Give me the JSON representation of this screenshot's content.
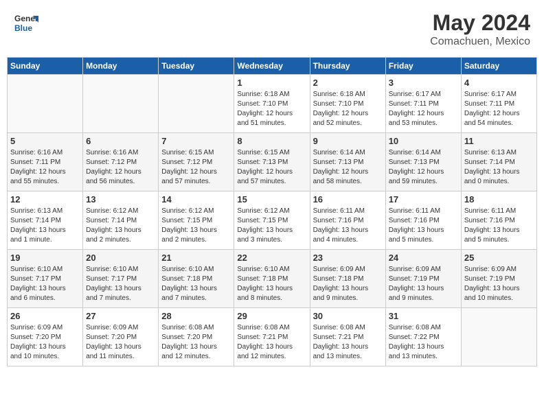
{
  "header": {
    "logo_general": "General",
    "logo_blue": "Blue",
    "month_year": "May 2024",
    "location": "Comachuen, Mexico"
  },
  "weekdays": [
    "Sunday",
    "Monday",
    "Tuesday",
    "Wednesday",
    "Thursday",
    "Friday",
    "Saturday"
  ],
  "weeks": [
    [
      {
        "day": "",
        "info": ""
      },
      {
        "day": "",
        "info": ""
      },
      {
        "day": "",
        "info": ""
      },
      {
        "day": "1",
        "info": "Sunrise: 6:18 AM\nSunset: 7:10 PM\nDaylight: 12 hours\nand 51 minutes."
      },
      {
        "day": "2",
        "info": "Sunrise: 6:18 AM\nSunset: 7:10 PM\nDaylight: 12 hours\nand 52 minutes."
      },
      {
        "day": "3",
        "info": "Sunrise: 6:17 AM\nSunset: 7:11 PM\nDaylight: 12 hours\nand 53 minutes."
      },
      {
        "day": "4",
        "info": "Sunrise: 6:17 AM\nSunset: 7:11 PM\nDaylight: 12 hours\nand 54 minutes."
      }
    ],
    [
      {
        "day": "5",
        "info": "Sunrise: 6:16 AM\nSunset: 7:11 PM\nDaylight: 12 hours\nand 55 minutes."
      },
      {
        "day": "6",
        "info": "Sunrise: 6:16 AM\nSunset: 7:12 PM\nDaylight: 12 hours\nand 56 minutes."
      },
      {
        "day": "7",
        "info": "Sunrise: 6:15 AM\nSunset: 7:12 PM\nDaylight: 12 hours\nand 57 minutes."
      },
      {
        "day": "8",
        "info": "Sunrise: 6:15 AM\nSunset: 7:13 PM\nDaylight: 12 hours\nand 57 minutes."
      },
      {
        "day": "9",
        "info": "Sunrise: 6:14 AM\nSunset: 7:13 PM\nDaylight: 12 hours\nand 58 minutes."
      },
      {
        "day": "10",
        "info": "Sunrise: 6:14 AM\nSunset: 7:13 PM\nDaylight: 12 hours\nand 59 minutes."
      },
      {
        "day": "11",
        "info": "Sunrise: 6:13 AM\nSunset: 7:14 PM\nDaylight: 13 hours\nand 0 minutes."
      }
    ],
    [
      {
        "day": "12",
        "info": "Sunrise: 6:13 AM\nSunset: 7:14 PM\nDaylight: 13 hours\nand 1 minute."
      },
      {
        "day": "13",
        "info": "Sunrise: 6:12 AM\nSunset: 7:14 PM\nDaylight: 13 hours\nand 2 minutes."
      },
      {
        "day": "14",
        "info": "Sunrise: 6:12 AM\nSunset: 7:15 PM\nDaylight: 13 hours\nand 2 minutes."
      },
      {
        "day": "15",
        "info": "Sunrise: 6:12 AM\nSunset: 7:15 PM\nDaylight: 13 hours\nand 3 minutes."
      },
      {
        "day": "16",
        "info": "Sunrise: 6:11 AM\nSunset: 7:16 PM\nDaylight: 13 hours\nand 4 minutes."
      },
      {
        "day": "17",
        "info": "Sunrise: 6:11 AM\nSunset: 7:16 PM\nDaylight: 13 hours\nand 5 minutes."
      },
      {
        "day": "18",
        "info": "Sunrise: 6:11 AM\nSunset: 7:16 PM\nDaylight: 13 hours\nand 5 minutes."
      }
    ],
    [
      {
        "day": "19",
        "info": "Sunrise: 6:10 AM\nSunset: 7:17 PM\nDaylight: 13 hours\nand 6 minutes."
      },
      {
        "day": "20",
        "info": "Sunrise: 6:10 AM\nSunset: 7:17 PM\nDaylight: 13 hours\nand 7 minutes."
      },
      {
        "day": "21",
        "info": "Sunrise: 6:10 AM\nSunset: 7:18 PM\nDaylight: 13 hours\nand 7 minutes."
      },
      {
        "day": "22",
        "info": "Sunrise: 6:10 AM\nSunset: 7:18 PM\nDaylight: 13 hours\nand 8 minutes."
      },
      {
        "day": "23",
        "info": "Sunrise: 6:09 AM\nSunset: 7:18 PM\nDaylight: 13 hours\nand 9 minutes."
      },
      {
        "day": "24",
        "info": "Sunrise: 6:09 AM\nSunset: 7:19 PM\nDaylight: 13 hours\nand 9 minutes."
      },
      {
        "day": "25",
        "info": "Sunrise: 6:09 AM\nSunset: 7:19 PM\nDaylight: 13 hours\nand 10 minutes."
      }
    ],
    [
      {
        "day": "26",
        "info": "Sunrise: 6:09 AM\nSunset: 7:20 PM\nDaylight: 13 hours\nand 10 minutes."
      },
      {
        "day": "27",
        "info": "Sunrise: 6:09 AM\nSunset: 7:20 PM\nDaylight: 13 hours\nand 11 minutes."
      },
      {
        "day": "28",
        "info": "Sunrise: 6:08 AM\nSunset: 7:20 PM\nDaylight: 13 hours\nand 12 minutes."
      },
      {
        "day": "29",
        "info": "Sunrise: 6:08 AM\nSunset: 7:21 PM\nDaylight: 13 hours\nand 12 minutes."
      },
      {
        "day": "30",
        "info": "Sunrise: 6:08 AM\nSunset: 7:21 PM\nDaylight: 13 hours\nand 13 minutes."
      },
      {
        "day": "31",
        "info": "Sunrise: 6:08 AM\nSunset: 7:22 PM\nDaylight: 13 hours\nand 13 minutes."
      },
      {
        "day": "",
        "info": ""
      }
    ]
  ]
}
